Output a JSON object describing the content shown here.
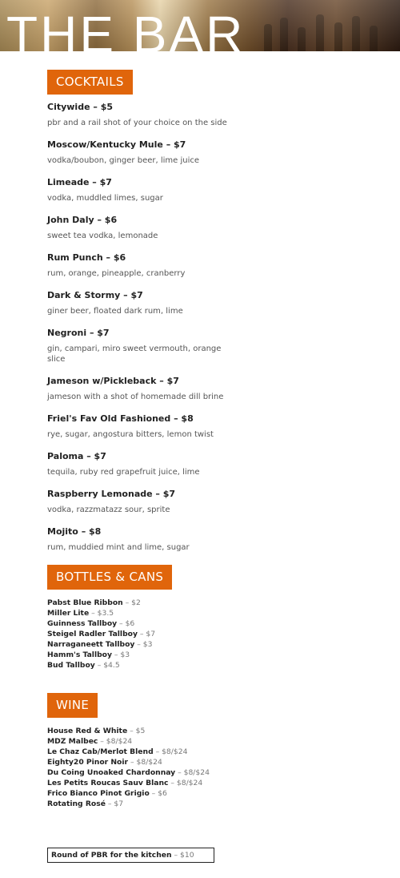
{
  "hero": {
    "title": "THE BAR"
  },
  "cocktails": {
    "heading": "COCKTAILS",
    "items": [
      {
        "name": "Citywide – $5",
        "desc": "pbr and a rail shot of your choice on the side"
      },
      {
        "name": "Moscow/Kentucky Mule – $7",
        "desc": "vodka/boubon, ginger beer, lime juice"
      },
      {
        "name": "Limeade – $7",
        "desc": "vodka, muddled limes, sugar"
      },
      {
        "name": "John Daly – $6",
        "desc": "sweet tea vodka, lemonade"
      },
      {
        "name": "Rum Punch – $6",
        "desc": "rum, orange, pineapple, cranberry"
      },
      {
        "name": "Dark & Stormy – $7",
        "desc": "giner beer, floated dark rum, lime"
      },
      {
        "name": "Negroni – $7",
        "desc": "gin, campari, miro sweet vermouth, orange slice"
      },
      {
        "name": "Jameson w/Pickleback – $7",
        "desc": "jameson with a shot of homemade dill brine"
      },
      {
        "name": "Friel's Fav Old Fashioned – $8",
        "desc": "rye, sugar, angostura bitters, lemon twist"
      },
      {
        "name": "Paloma – $7",
        "desc": "tequila, ruby red grapefruit juice, lime"
      },
      {
        "name": "Raspberry Lemonade – $7",
        "desc": "vodka, razzmatazz sour, sprite"
      },
      {
        "name": "Mojito – $8",
        "desc": "rum, muddied mint and lime, sugar"
      }
    ]
  },
  "bottles": {
    "heading": "BOTTLES & CANS",
    "items": [
      {
        "name": "Pabst Blue Ribbon",
        "price": " – $2"
      },
      {
        "name": "Miller Lite",
        "price": " – $3.5"
      },
      {
        "name": "Guinness Tallboy",
        "price": " – $6"
      },
      {
        "name": "Steigel Radler Tallboy",
        "price": " – $7"
      },
      {
        "name": "Narraganeett Tallboy",
        "price": " – $3"
      },
      {
        "name": "Hamm's Tallboy",
        "price": " – $3"
      },
      {
        "name": "Bud Tallboy",
        "price": " – $4.5"
      }
    ]
  },
  "wine": {
    "heading": "WINE",
    "items": [
      {
        "name": "House Red & White",
        "price": " – $5"
      },
      {
        "name": "MDZ Malbec",
        "price": " – $8/$24"
      },
      {
        "name": "Le Chaz Cab/Merlot Blend",
        "price": " – $8/$24"
      },
      {
        "name": "Eighty20 Pinor Noir",
        "price": " – $8/$24"
      },
      {
        "name": "Du Coing Unoaked Chardonnay",
        "price": " – $8/$24"
      },
      {
        "name": "Les Petits Roucas Sauv Blanc",
        "price": " – $8/$24"
      },
      {
        "name": "Frico Bianco Pinot Grigio",
        "price": " – $6"
      },
      {
        "name": "Rotating Rosé",
        "price": " – $7"
      }
    ]
  },
  "kitchen": {
    "name": "Round of PBR for the kitchen",
    "price": " – $10"
  }
}
